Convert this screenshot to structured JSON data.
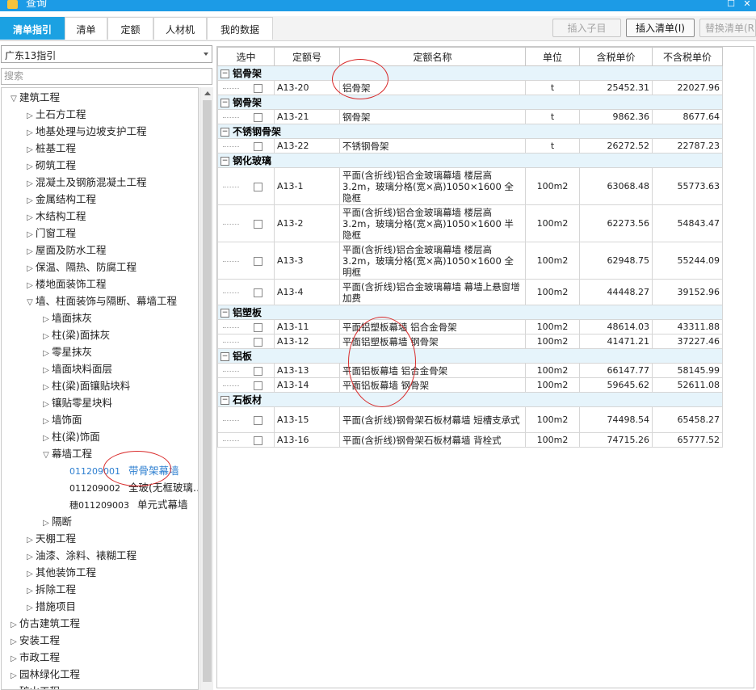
{
  "window": {
    "title": "查询",
    "maximize_glyph": "☐",
    "close_glyph": "✕"
  },
  "tabs": [
    {
      "label": "清单指引",
      "active": true
    },
    {
      "label": "清单"
    },
    {
      "label": "定额"
    },
    {
      "label": "人材机"
    },
    {
      "label": "我的数据"
    }
  ],
  "toolbar": {
    "insert_child": "插入子目",
    "insert_list": "插入清单(I)",
    "replace_list": "替换清单(R)"
  },
  "left": {
    "select_value": "广东13指引",
    "search_placeholder": "搜索",
    "tree": [
      {
        "t": "▽",
        "label": "建筑工程"
      },
      {
        "t": "▷",
        "label": "土石方工程"
      },
      {
        "t": "▷",
        "label": "地基处理与边坡支护工程"
      },
      {
        "t": "▷",
        "label": "桩基工程"
      },
      {
        "t": "▷",
        "label": "砌筑工程"
      },
      {
        "t": "▷",
        "label": "混凝土及钢筋混凝土工程"
      },
      {
        "t": "▷",
        "label": "金属结构工程"
      },
      {
        "t": "▷",
        "label": "木结构工程"
      },
      {
        "t": "▷",
        "label": "门窗工程"
      },
      {
        "t": "▷",
        "label": "屋面及防水工程"
      },
      {
        "t": "▷",
        "label": "保温、隔热、防腐工程"
      },
      {
        "t": "▷",
        "label": "楼地面装饰工程"
      },
      {
        "t": "▽",
        "label": "墙、柱面装饰与隔断、幕墙工程"
      },
      {
        "t": "▷",
        "label": "墙面抹灰"
      },
      {
        "t": "▷",
        "label": "柱(梁)面抹灰"
      },
      {
        "t": "▷",
        "label": "零星抹灰"
      },
      {
        "t": "▷",
        "label": "墙面块料面层"
      },
      {
        "t": "▷",
        "label": "柱(梁)面镶贴块料"
      },
      {
        "t": "▷",
        "label": "镶贴零星块料"
      },
      {
        "t": "▷",
        "label": "墙饰面"
      },
      {
        "t": "▷",
        "label": "柱(梁)饰面"
      },
      {
        "t": "▽",
        "label": "幕墙工程"
      },
      {
        "t": "",
        "code": "011209001",
        "label": "带骨架幕墙",
        "selected": true
      },
      {
        "t": "",
        "code": "011209002",
        "label": "全玻(无框玻璃…"
      },
      {
        "t": "",
        "code": "穗011209003",
        "label": "单元式幕墙"
      },
      {
        "t": "▷",
        "label": "隔断"
      },
      {
        "t": "▷",
        "label": "天棚工程"
      },
      {
        "t": "▷",
        "label": "油漆、涂料、裱糊工程"
      },
      {
        "t": "▷",
        "label": "其他装饰工程"
      },
      {
        "t": "▷",
        "label": "拆除工程"
      },
      {
        "t": "▷",
        "label": "措施项目"
      },
      {
        "t": "▷",
        "label": "仿古建筑工程"
      },
      {
        "t": "▷",
        "label": "安装工程"
      },
      {
        "t": "▷",
        "label": "市政工程"
      },
      {
        "t": "▷",
        "label": "园林绿化工程"
      },
      {
        "t": "▷",
        "label": "矿山工程"
      }
    ]
  },
  "table": {
    "headers": [
      "选中",
      "定额号",
      "定额名称",
      "单位",
      "含税单价",
      "不含税单价"
    ],
    "groups": [
      {
        "name": "铝骨架",
        "rows": [
          {
            "code": "A13-20",
            "name": "铝骨架",
            "unit": "t",
            "price": "25452.31",
            "price_ex": "22027.96"
          }
        ]
      },
      {
        "name": "钢骨架",
        "rows": [
          {
            "code": "A13-21",
            "name": "钢骨架",
            "unit": "t",
            "price": "9862.36",
            "price_ex": "8677.64"
          }
        ]
      },
      {
        "name": "不锈钢骨架",
        "rows": [
          {
            "code": "A13-22",
            "name": "不锈钢骨架",
            "unit": "t",
            "price": "26272.52",
            "price_ex": "22787.23"
          }
        ]
      },
      {
        "name": "钢化玻璃",
        "rows": [
          {
            "code": "A13-1",
            "name": "平面(含折线)铝合金玻璃幕墙 楼层高3.2m，玻璃分格(宽×高)1050×1600 全隐框",
            "unit": "100m2",
            "price": "63068.48",
            "price_ex": "55773.63"
          },
          {
            "code": "A13-2",
            "name": "平面(含折线)铝合金玻璃幕墙 楼层高3.2m，玻璃分格(宽×高)1050×1600 半隐框",
            "unit": "100m2",
            "price": "62273.56",
            "price_ex": "54843.47"
          },
          {
            "code": "A13-3",
            "name": "平面(含折线)铝合金玻璃幕墙 楼层高3.2m，玻璃分格(宽×高)1050×1600 全明框",
            "unit": "100m2",
            "price": "62948.75",
            "price_ex": "55244.09"
          },
          {
            "code": "A13-4",
            "name": "平面(含折线)铝合金玻璃幕墙 幕墙上悬窗增加费",
            "unit": "100m2",
            "price": "44448.27",
            "price_ex": "39152.96"
          }
        ]
      },
      {
        "name": "铝塑板",
        "rows": [
          {
            "code": "A13-11",
            "name": "平面铝塑板幕墙 铝合金骨架",
            "unit": "100m2",
            "price": "48614.03",
            "price_ex": "43311.88"
          },
          {
            "code": "A13-12",
            "name": "平面铝塑板幕墙 钢骨架",
            "unit": "100m2",
            "price": "41471.21",
            "price_ex": "37227.46"
          }
        ]
      },
      {
        "name": "铝板",
        "rows": [
          {
            "code": "A13-13",
            "name": "平面铝板幕墙 铝合金骨架",
            "unit": "100m2",
            "price": "66147.77",
            "price_ex": "58145.99"
          },
          {
            "code": "A13-14",
            "name": "平面铝板幕墙 钢骨架",
            "unit": "100m2",
            "price": "59645.62",
            "price_ex": "52611.08"
          }
        ]
      },
      {
        "name": "石板材",
        "rows": [
          {
            "code": "A13-15",
            "name": "平面(含折线)钢骨架石板材幕墙 短槽支承式",
            "unit": "100m2",
            "price": "74498.54",
            "price_ex": "65458.27"
          },
          {
            "code": "A13-16",
            "name": "平面(含折线)钢骨架石板材幕墙 背栓式",
            "unit": "100m2",
            "price": "74715.26",
            "price_ex": "65777.52"
          }
        ]
      }
    ]
  },
  "colors": {
    "accent": "#1ba1e2",
    "titlebar": "#1c9be6",
    "group_bg": "#e6f4fb",
    "annotation": "#d92a2a"
  }
}
